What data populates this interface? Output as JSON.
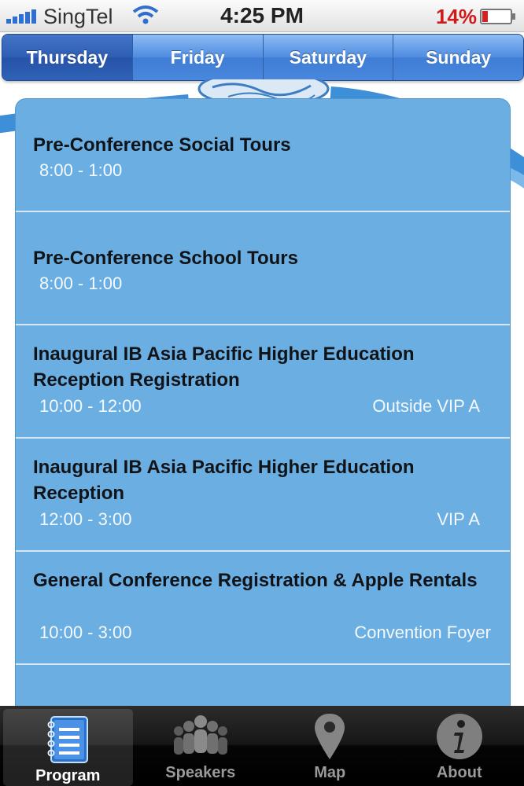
{
  "status_bar": {
    "carrier": "SingTel",
    "time": "4:25 PM",
    "battery": "14%"
  },
  "day_tabs": [
    {
      "label": "Thursday",
      "selected": true
    },
    {
      "label": "Friday",
      "selected": false
    },
    {
      "label": "Saturday",
      "selected": false
    },
    {
      "label": "Sunday",
      "selected": false
    }
  ],
  "sessions": [
    {
      "title": "Pre-Conference Social Tours",
      "time": "8:00 - 1:00",
      "room": ""
    },
    {
      "title": "Pre-Conference School Tours",
      "time": "8:00 - 1:00",
      "room": ""
    },
    {
      "title": "Inaugural IB Asia Pacific Higher Education Reception Registration",
      "time": "10:00 - 12:00",
      "room": "Outside VIP A"
    },
    {
      "title": "Inaugural IB Asia Pacific Higher Education Reception",
      "time": "12:00 - 3:00",
      "room": "VIP A"
    },
    {
      "title": "General Conference Registration & Apple Rentals",
      "time": "10:00 - 3:00",
      "room": "Convention Foyer"
    }
  ],
  "tab_bar": [
    {
      "label": "Program",
      "icon": "notebook-icon",
      "selected": true
    },
    {
      "label": "Speakers",
      "icon": "people-icon",
      "selected": false
    },
    {
      "label": "Map",
      "icon": "map-pin-icon",
      "selected": false
    },
    {
      "label": "About",
      "icon": "info-icon",
      "selected": false
    }
  ],
  "colors": {
    "list_background": "#6aaee2",
    "selected_segment": "#2d5eb5",
    "battery_low": "#cf1a1a"
  }
}
